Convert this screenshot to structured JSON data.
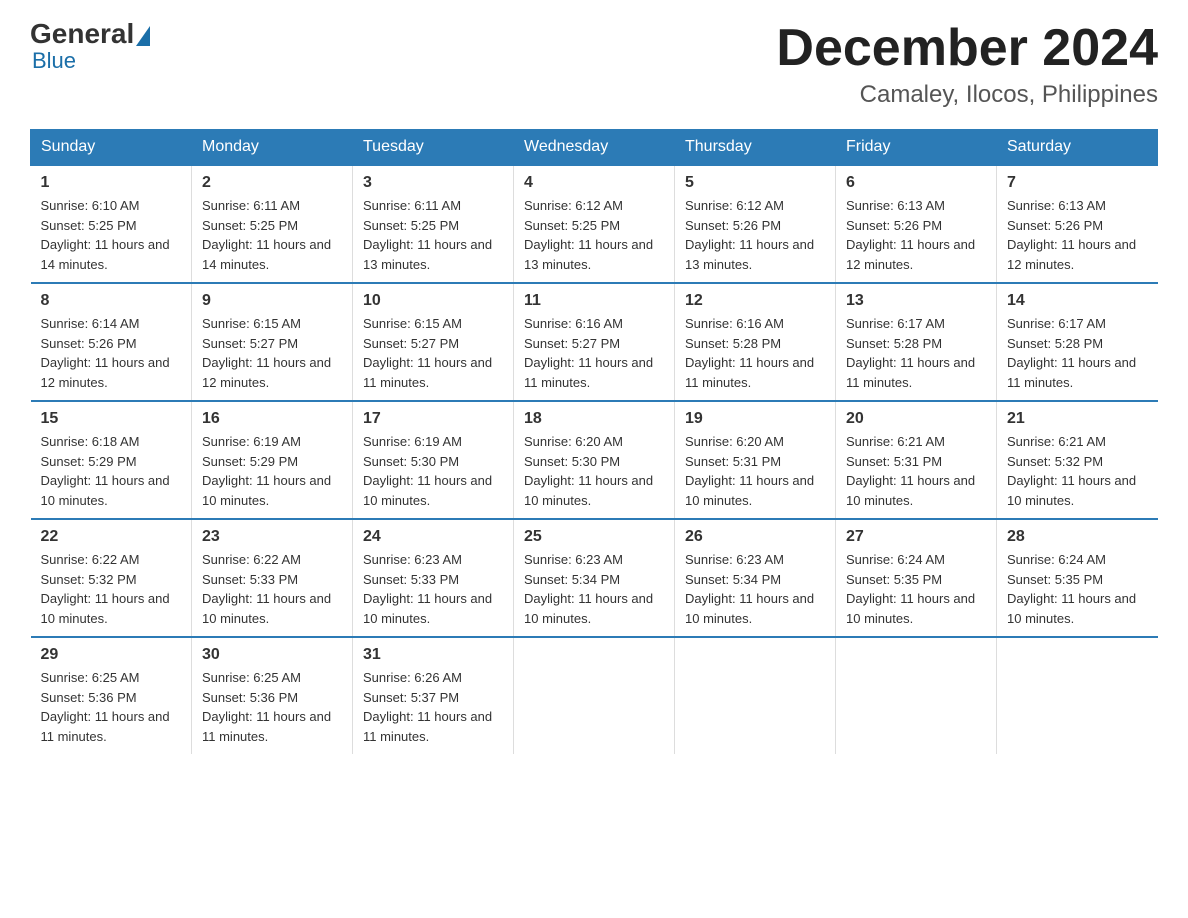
{
  "logo": {
    "general": "General",
    "blue": "Blue"
  },
  "header": {
    "month": "December 2024",
    "location": "Camaley, Ilocos, Philippines"
  },
  "days_of_week": [
    "Sunday",
    "Monday",
    "Tuesday",
    "Wednesday",
    "Thursday",
    "Friday",
    "Saturday"
  ],
  "weeks": [
    [
      {
        "day": "1",
        "sunrise": "6:10 AM",
        "sunset": "5:25 PM",
        "daylight": "11 hours and 14 minutes."
      },
      {
        "day": "2",
        "sunrise": "6:11 AM",
        "sunset": "5:25 PM",
        "daylight": "11 hours and 14 minutes."
      },
      {
        "day": "3",
        "sunrise": "6:11 AM",
        "sunset": "5:25 PM",
        "daylight": "11 hours and 13 minutes."
      },
      {
        "day": "4",
        "sunrise": "6:12 AM",
        "sunset": "5:25 PM",
        "daylight": "11 hours and 13 minutes."
      },
      {
        "day": "5",
        "sunrise": "6:12 AM",
        "sunset": "5:26 PM",
        "daylight": "11 hours and 13 minutes."
      },
      {
        "day": "6",
        "sunrise": "6:13 AM",
        "sunset": "5:26 PM",
        "daylight": "11 hours and 12 minutes."
      },
      {
        "day": "7",
        "sunrise": "6:13 AM",
        "sunset": "5:26 PM",
        "daylight": "11 hours and 12 minutes."
      }
    ],
    [
      {
        "day": "8",
        "sunrise": "6:14 AM",
        "sunset": "5:26 PM",
        "daylight": "11 hours and 12 minutes."
      },
      {
        "day": "9",
        "sunrise": "6:15 AM",
        "sunset": "5:27 PM",
        "daylight": "11 hours and 12 minutes."
      },
      {
        "day": "10",
        "sunrise": "6:15 AM",
        "sunset": "5:27 PM",
        "daylight": "11 hours and 11 minutes."
      },
      {
        "day": "11",
        "sunrise": "6:16 AM",
        "sunset": "5:27 PM",
        "daylight": "11 hours and 11 minutes."
      },
      {
        "day": "12",
        "sunrise": "6:16 AM",
        "sunset": "5:28 PM",
        "daylight": "11 hours and 11 minutes."
      },
      {
        "day": "13",
        "sunrise": "6:17 AM",
        "sunset": "5:28 PM",
        "daylight": "11 hours and 11 minutes."
      },
      {
        "day": "14",
        "sunrise": "6:17 AM",
        "sunset": "5:28 PM",
        "daylight": "11 hours and 11 minutes."
      }
    ],
    [
      {
        "day": "15",
        "sunrise": "6:18 AM",
        "sunset": "5:29 PM",
        "daylight": "11 hours and 10 minutes."
      },
      {
        "day": "16",
        "sunrise": "6:19 AM",
        "sunset": "5:29 PM",
        "daylight": "11 hours and 10 minutes."
      },
      {
        "day": "17",
        "sunrise": "6:19 AM",
        "sunset": "5:30 PM",
        "daylight": "11 hours and 10 minutes."
      },
      {
        "day": "18",
        "sunrise": "6:20 AM",
        "sunset": "5:30 PM",
        "daylight": "11 hours and 10 minutes."
      },
      {
        "day": "19",
        "sunrise": "6:20 AM",
        "sunset": "5:31 PM",
        "daylight": "11 hours and 10 minutes."
      },
      {
        "day": "20",
        "sunrise": "6:21 AM",
        "sunset": "5:31 PM",
        "daylight": "11 hours and 10 minutes."
      },
      {
        "day": "21",
        "sunrise": "6:21 AM",
        "sunset": "5:32 PM",
        "daylight": "11 hours and 10 minutes."
      }
    ],
    [
      {
        "day": "22",
        "sunrise": "6:22 AM",
        "sunset": "5:32 PM",
        "daylight": "11 hours and 10 minutes."
      },
      {
        "day": "23",
        "sunrise": "6:22 AM",
        "sunset": "5:33 PM",
        "daylight": "11 hours and 10 minutes."
      },
      {
        "day": "24",
        "sunrise": "6:23 AM",
        "sunset": "5:33 PM",
        "daylight": "11 hours and 10 minutes."
      },
      {
        "day": "25",
        "sunrise": "6:23 AM",
        "sunset": "5:34 PM",
        "daylight": "11 hours and 10 minutes."
      },
      {
        "day": "26",
        "sunrise": "6:23 AM",
        "sunset": "5:34 PM",
        "daylight": "11 hours and 10 minutes."
      },
      {
        "day": "27",
        "sunrise": "6:24 AM",
        "sunset": "5:35 PM",
        "daylight": "11 hours and 10 minutes."
      },
      {
        "day": "28",
        "sunrise": "6:24 AM",
        "sunset": "5:35 PM",
        "daylight": "11 hours and 10 minutes."
      }
    ],
    [
      {
        "day": "29",
        "sunrise": "6:25 AM",
        "sunset": "5:36 PM",
        "daylight": "11 hours and 11 minutes."
      },
      {
        "day": "30",
        "sunrise": "6:25 AM",
        "sunset": "5:36 PM",
        "daylight": "11 hours and 11 minutes."
      },
      {
        "day": "31",
        "sunrise": "6:26 AM",
        "sunset": "5:37 PM",
        "daylight": "11 hours and 11 minutes."
      },
      null,
      null,
      null,
      null
    ]
  ],
  "labels": {
    "sunrise": "Sunrise:",
    "sunset": "Sunset:",
    "daylight": "Daylight:"
  }
}
